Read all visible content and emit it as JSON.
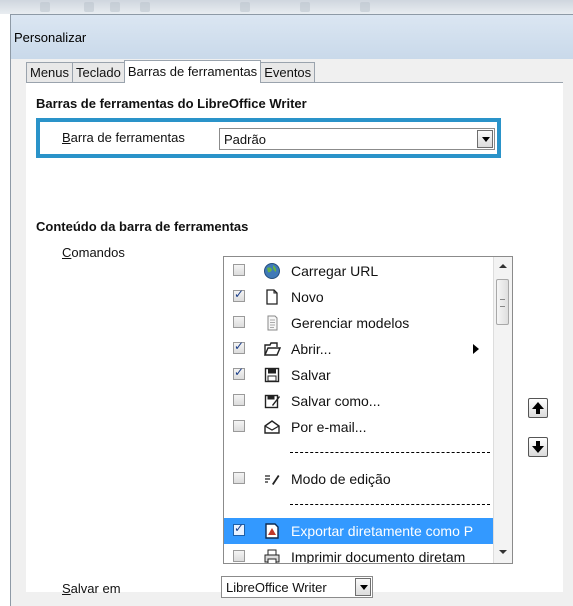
{
  "window": {
    "title": "Personalizar"
  },
  "tabs": [
    {
      "label": "Menus",
      "active": false
    },
    {
      "label": "Teclado",
      "active": false
    },
    {
      "label": "Barras de ferramentas",
      "active": true
    },
    {
      "label": "Eventos",
      "active": false
    }
  ],
  "toolbars_section": {
    "title": "Barras de ferramentas do LibreOffice Writer",
    "toolbar_label": "Barra de ferramentas",
    "toolbar_mnemonic": "B",
    "toolbar_rest": "arra de ferramentas",
    "toolbar_value": "Padrão"
  },
  "content_section": {
    "title": "Conteúdo da barra de ferramentas",
    "commands_label": "Comandos",
    "commands_mnemonic": "C",
    "commands_rest": "omandos"
  },
  "commands": [
    {
      "type": "item",
      "label": "Carregar URL",
      "checked": false,
      "icon": "globe-icon"
    },
    {
      "type": "item",
      "label": "Novo",
      "checked": true,
      "icon": "new-document-icon"
    },
    {
      "type": "item",
      "label": "Gerenciar modelos",
      "checked": false,
      "icon": "templates-icon"
    },
    {
      "type": "item",
      "label": "Abrir...",
      "checked": true,
      "icon": "open-folder-icon",
      "submenu": true
    },
    {
      "type": "item",
      "label": "Salvar",
      "checked": true,
      "icon": "save-icon"
    },
    {
      "type": "item",
      "label": "Salvar como...",
      "checked": false,
      "icon": "save-as-icon"
    },
    {
      "type": "item",
      "label": "Por e-mail...",
      "checked": false,
      "icon": "email-icon"
    },
    {
      "type": "separator"
    },
    {
      "type": "item",
      "label": "Modo de edição",
      "checked": false,
      "icon": "edit-mode-icon"
    },
    {
      "type": "separator"
    },
    {
      "type": "item",
      "label": "Exportar diretamente como P",
      "checked": true,
      "icon": "export-pdf-icon",
      "selected": true
    },
    {
      "type": "item",
      "label": "Imprimir documento diretam",
      "checked": false,
      "icon": "print-icon"
    }
  ],
  "save_in": {
    "label": "Salvar em",
    "mnemonic": "S",
    "rest": "alvar em",
    "value": "LibreOffice Writer"
  },
  "colors": {
    "highlight_border": "#2a93c9",
    "selection": "#3399ff",
    "title_bar": "#c9d9ea"
  }
}
